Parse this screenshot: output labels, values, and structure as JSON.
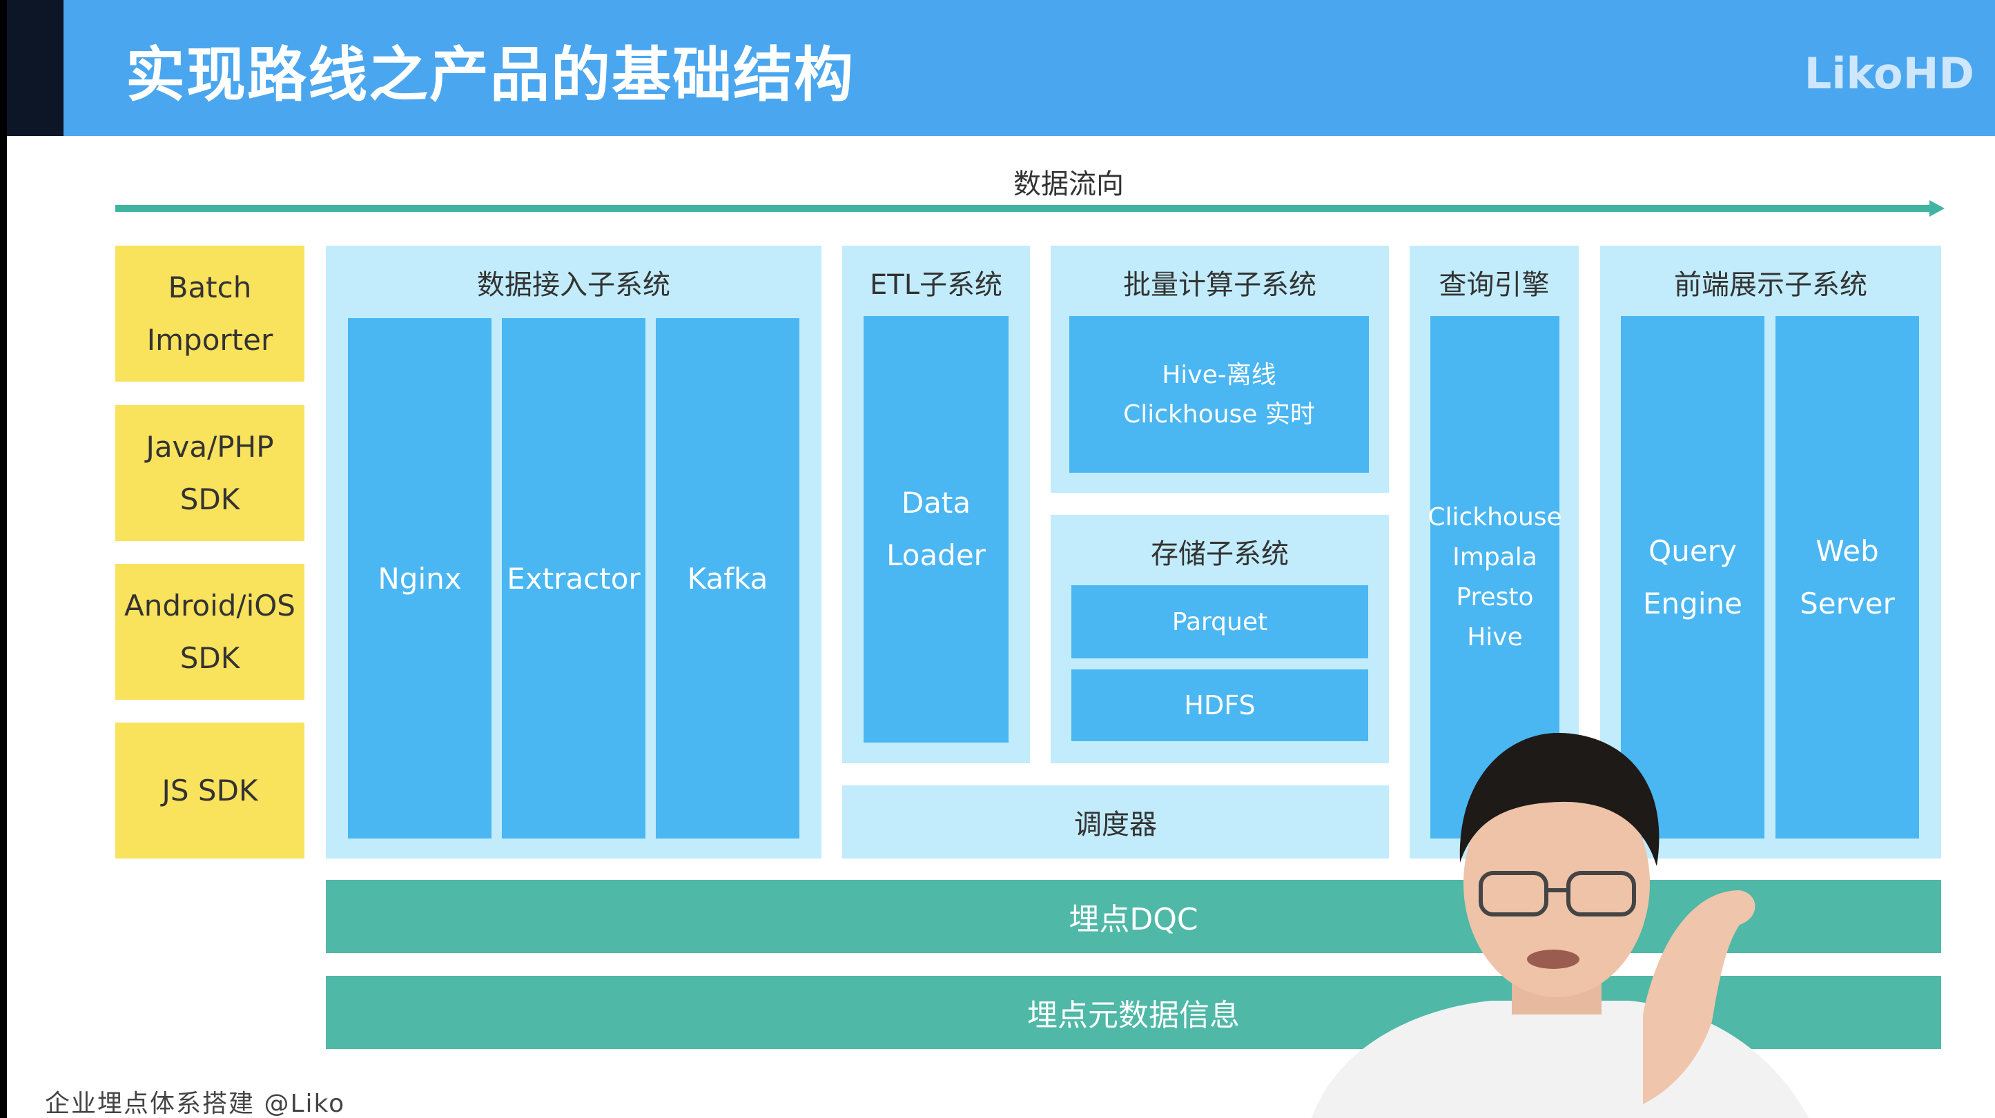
{
  "header": {
    "title": "实现路线之产品的基础结构",
    "logo": "LikoHD"
  },
  "diagram": {
    "flow_label": "数据流向",
    "sources": [
      "Batch\nImporter",
      "Java/PHP\nSDK",
      "Android/iOS\nSDK",
      "JS SDK"
    ],
    "ingest": {
      "title": "数据接入子系统",
      "components": [
        "Nginx",
        "Extractor",
        "Kafka"
      ]
    },
    "etl": {
      "title": "ETL子系统",
      "component": "Data\nLoader"
    },
    "batch": {
      "title": "批量计算子系统",
      "component": "Hive-离线\nClickhouse 实时"
    },
    "storage": {
      "title": "存储子系统",
      "components": [
        "Parquet",
        "HDFS"
      ]
    },
    "scheduler": "调度器",
    "query": {
      "title": "查询引擎",
      "component": "Clickhouse\nImpala\nPresto\nHive"
    },
    "frontend": {
      "title": "前端展示子系统",
      "components": [
        "Query\nEngine",
        "Web\nServer"
      ]
    },
    "dqc": "埋点DQC",
    "metadata": "埋点元数据信息"
  },
  "footer": "企业埋点体系搭建 @Liko",
  "colors": {
    "header": "#4aa6ef",
    "source": "#f9e25c",
    "panel": "#c2ecfb",
    "component": "#4ab6f2",
    "bar": "#4fb8a7"
  }
}
